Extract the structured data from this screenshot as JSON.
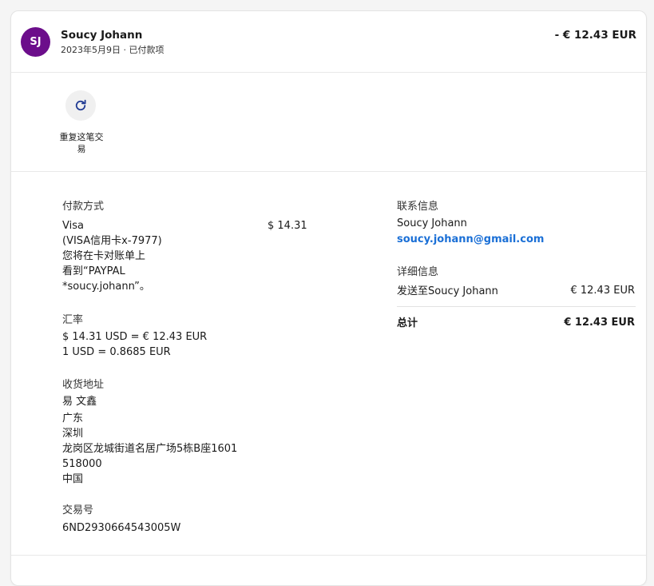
{
  "header": {
    "avatar_initials": "SJ",
    "avatar_color": "#6c0e8b",
    "name": "Soucy Johann",
    "date_status": "2023年5月9日 · 已付款项",
    "amount": "- € 12.43 EUR"
  },
  "actions": {
    "repeat_icon": "refresh-icon",
    "repeat_label_line1": "重复这笔交",
    "repeat_label_line2": "易"
  },
  "payment": {
    "title": "付款方式",
    "card_name": "Visa",
    "card_detail": "(VISA信用卡x-7977)",
    "statement_line1": "您将在卡对账单上",
    "statement_line2": "看到“PAYPAL",
    "statement_line3": "*soucy.johann”。",
    "amount": "$ 14.31"
  },
  "exchange": {
    "title": "汇率",
    "line1": "$ 14.31 USD = € 12.43 EUR",
    "line2": "1 USD = 0.8685 EUR"
  },
  "shipping": {
    "title": "收货地址",
    "name": "易 文鑫",
    "province": "广东",
    "city": "深圳",
    "street": "龙岗区龙城街道名居广场5栋B座1601",
    "postcode": "518000",
    "country": "中国"
  },
  "transaction": {
    "title": "交易号",
    "id": "6ND2930664543005W"
  },
  "contact": {
    "title": "联系信息",
    "name": "Soucy Johann",
    "email": "soucy.johann@gmail.com"
  },
  "detail_info": {
    "title": "详细信息",
    "sent_to": "发送至Soucy Johann",
    "sent_amount": "€ 12.43 EUR",
    "total_label": "总计",
    "total_amount": "€ 12.43 EUR"
  },
  "colors": {
    "link": "#1a6fd6",
    "avatar": "#6c0e8b"
  }
}
